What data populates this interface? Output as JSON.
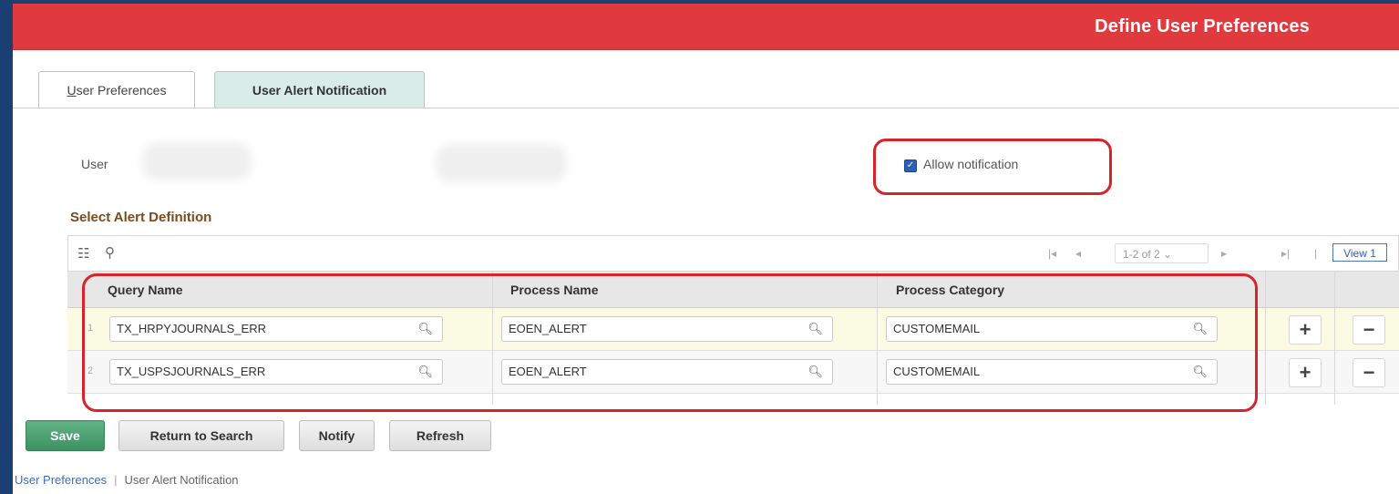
{
  "header": {
    "title": "Define User Preferences"
  },
  "tabs": [
    {
      "label": "User Preferences",
      "mnemonic": "U",
      "rest": "ser Preferences",
      "active": false
    },
    {
      "label": "User Alert Notification",
      "active": true
    }
  ],
  "user": {
    "label": "User"
  },
  "allow": {
    "label": "Allow notification",
    "checked": true
  },
  "section": {
    "title": "Select Alert Definition"
  },
  "pager": {
    "first": "|◂",
    "prev": "◂",
    "range": "1-2 of 2",
    "next": "▸",
    "last": "▸|",
    "sep": "|",
    "view": "View 1"
  },
  "grid": {
    "columns": [
      "Query Name",
      "Process Name",
      "Process Category"
    ],
    "rows": [
      {
        "num": "1",
        "query": "TX_HRPYJOURNALS_ERR",
        "process": "EOEN_ALERT",
        "category": "CUSTOMEMAIL"
      },
      {
        "num": "2",
        "query": "TX_USPSJOURNALS_ERR",
        "process": "EOEN_ALERT",
        "category": "CUSTOMEMAIL"
      }
    ],
    "add": "+",
    "delete": "−"
  },
  "buttons": {
    "save": "Save",
    "return": "Return to Search",
    "notify": "Notify",
    "refresh": "Refresh"
  },
  "footer": {
    "link1": "User Preferences",
    "sep": "|",
    "link2": "User Alert Notification"
  },
  "colors": {
    "banner": "#e03a3e",
    "highlight": "#d8232a",
    "save": "#4fa273",
    "active_tab": "#d9ece8"
  }
}
